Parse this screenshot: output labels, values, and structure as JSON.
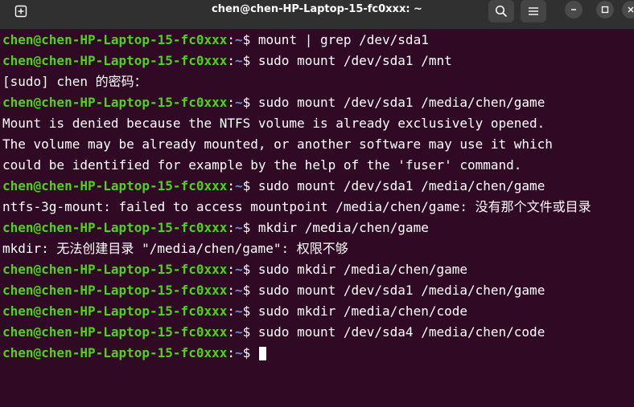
{
  "window": {
    "title": "chen@chen-HP-Laptop-15-fc0xxx: ~"
  },
  "colors": {
    "background": "#300a24",
    "titlebar": "#303030",
    "prompt_user": "#4ed318",
    "prompt_path": "#6b8fd9",
    "text": "#ffffff"
  },
  "icons": {
    "new_tab": "new-tab-icon",
    "search": "search-icon",
    "menu": "hamburger-menu-icon",
    "minimize": "minimize-icon",
    "maximize": "maximize-icon",
    "close": "close-icon"
  },
  "prompt": {
    "user_host": "chen@chen-HP-Laptop-15-fc0xxx",
    "colon": ":",
    "path": "~",
    "symbol": "$ "
  },
  "lines": [
    {
      "type": "prompt",
      "command": "mount | grep /dev/sda1"
    },
    {
      "type": "prompt",
      "command": "sudo mount /dev/sda1 /mnt"
    },
    {
      "type": "output",
      "text": "[sudo] chen 的密码："
    },
    {
      "type": "prompt",
      "command": "sudo mount /dev/sda1 /media/chen/game"
    },
    {
      "type": "output",
      "text": "Mount is denied because the NTFS volume is already exclusively opened."
    },
    {
      "type": "output",
      "text": "The volume may be already mounted, or another software may use it which"
    },
    {
      "type": "output",
      "text": "could be identified for example by the help of the 'fuser' command."
    },
    {
      "type": "prompt",
      "command": "sudo mount /dev/sda1 /media/chen/game"
    },
    {
      "type": "output",
      "text": "ntfs-3g-mount: failed to access mountpoint /media/chen/game: 没有那个文件或目录"
    },
    {
      "type": "prompt",
      "command": "mkdir /media/chen/game"
    },
    {
      "type": "output",
      "text": "mkdir: 无法创建目录 \"/media/chen/game\": 权限不够"
    },
    {
      "type": "prompt",
      "command": "sudo mkdir /media/chen/game"
    },
    {
      "type": "prompt",
      "command": "sudo mount /dev/sda1 /media/chen/game"
    },
    {
      "type": "prompt",
      "command": "sudo mkdir /media/chen/code"
    },
    {
      "type": "prompt",
      "command": "sudo mount /dev/sda4 /media/chen/code"
    },
    {
      "type": "prompt",
      "command": ""
    }
  ]
}
